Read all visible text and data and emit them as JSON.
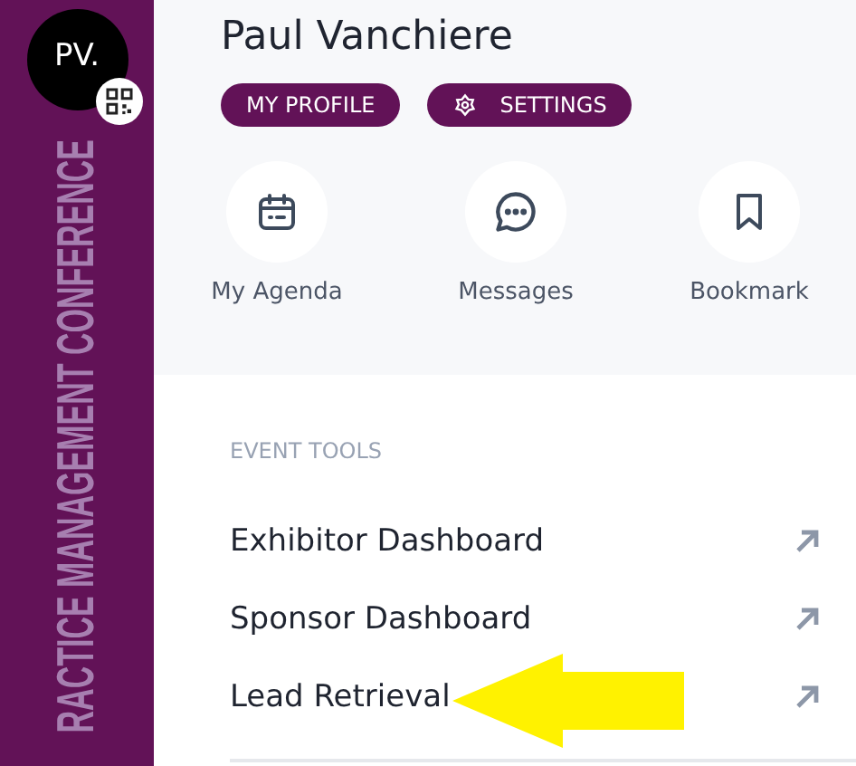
{
  "sidebar": {
    "avatar_initials": "PV.",
    "vertical_title": "RACTICE MANAGEMENT CONFERENCE"
  },
  "profile": {
    "name": "Paul Vanchiere",
    "buttons": [
      {
        "label": "MY PROFILE",
        "kind": "plain"
      },
      {
        "label": "SETTINGS",
        "kind": "settings"
      }
    ]
  },
  "shortcuts": [
    {
      "label": "My Agenda",
      "kind": "calendar"
    },
    {
      "label": "Messages",
      "kind": "chat"
    },
    {
      "label": "Bookmark",
      "kind": "bookmark"
    }
  ],
  "event_tools": {
    "heading": "EVENT TOOLS",
    "items": [
      {
        "label": "Exhibitor Dashboard",
        "highlighted": false
      },
      {
        "label": "Sponsor Dashboard",
        "highlighted": false
      },
      {
        "label": "Lead Retrieval",
        "highlighted": true
      }
    ]
  }
}
